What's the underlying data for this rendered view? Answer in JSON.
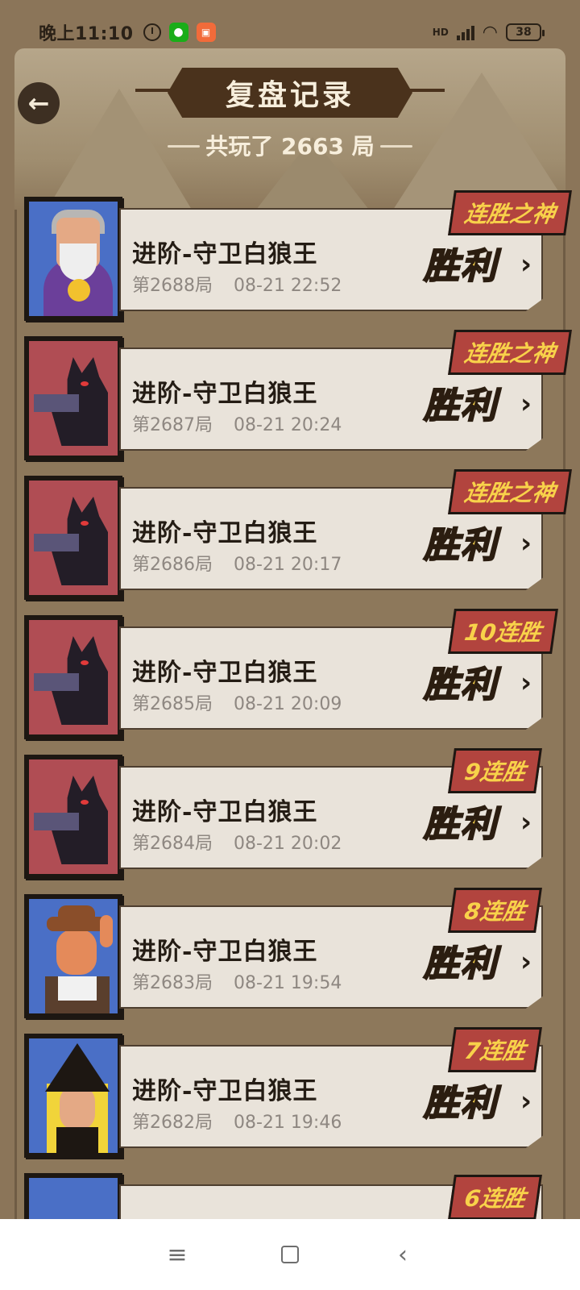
{
  "status_bar": {
    "time": "晚上11:10",
    "network": "HD",
    "battery": "38"
  },
  "header": {
    "title": "复盘记录",
    "total_games": "共玩了 2663 局"
  },
  "records": [
    {
      "game": "进阶-守卫白狼王",
      "round": "第2688局",
      "date": "08-21 22:52",
      "streak": "连胜之神",
      "result": "胜利",
      "avatar": "wizard-avatar"
    },
    {
      "game": "进阶-守卫白狼王",
      "round": "第2687局",
      "date": "08-21 20:24",
      "streak": "连胜之神",
      "result": "胜利",
      "avatar": "wolf-avatar"
    },
    {
      "game": "进阶-守卫白狼王",
      "round": "第2686局",
      "date": "08-21 20:17",
      "streak": "连胜之神",
      "result": "胜利",
      "avatar": "wolf-avatar"
    },
    {
      "game": "进阶-守卫白狼王",
      "round": "第2685局",
      "date": "08-21 20:09",
      "streak": "10连胜",
      "result": "胜利",
      "avatar": "wolf-avatar"
    },
    {
      "game": "进阶-守卫白狼王",
      "round": "第2684局",
      "date": "08-21 20:02",
      "streak": "9连胜",
      "result": "胜利",
      "avatar": "wolf-avatar"
    },
    {
      "game": "进阶-守卫白狼王",
      "round": "第2683局",
      "date": "08-21 19:54",
      "streak": "8连胜",
      "result": "胜利",
      "avatar": "farmer-avatar"
    },
    {
      "game": "进阶-守卫白狼王",
      "round": "第2682局",
      "date": "08-21 19:46",
      "streak": "7连胜",
      "result": "胜利",
      "avatar": "witch-avatar"
    },
    {
      "game": "",
      "round": "",
      "date": "",
      "streak": "6连胜",
      "result": "",
      "avatar": "partial-avatar"
    }
  ],
  "icons": {
    "back": "arrow-left-icon",
    "chevron": "chevron-right-icon"
  },
  "colors": {
    "background": "#8a7356",
    "card": "#e9e3da",
    "streak_badge": "#b2443e",
    "result_gold": "#f9d34b"
  }
}
